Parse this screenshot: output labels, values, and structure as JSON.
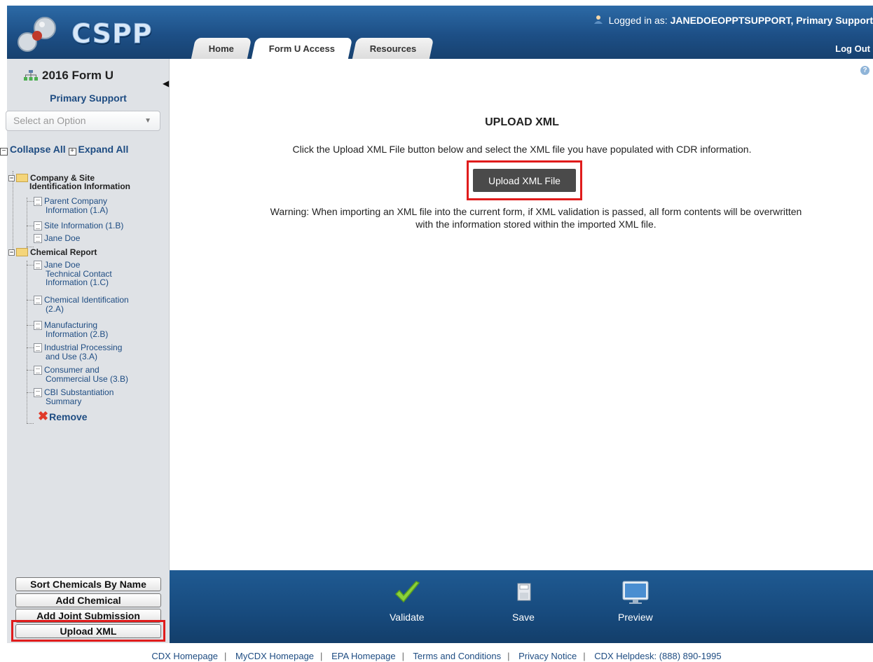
{
  "header": {
    "logo_text": "CSPP",
    "logged_in_label": "Logged in as:",
    "user_name": "JANEDOEOPPTSUPPORT, Primary Support",
    "logout_label": "Log Out",
    "tabs": [
      {
        "label": "Home",
        "active": false
      },
      {
        "label": "Form U Access",
        "active": true
      },
      {
        "label": "Resources",
        "active": false
      }
    ]
  },
  "sidebar": {
    "form_title": "2016 Form U",
    "role": "Primary Support",
    "select_placeholder": "Select an Option",
    "collapse_all": "Collapse All",
    "expand_all": "Expand All",
    "tree": {
      "group1_line1": "Company & Site",
      "group1_line2": "Identification Information",
      "g1_item1_l1": "Parent Company",
      "g1_item1_l2": "Information (1.A)",
      "g1_item2": "Site Information (1.B)",
      "g1_item3": "Jane Doe",
      "group2": "Chemical Report",
      "g2_item1_l1": "Jane Doe",
      "g2_item1_l2": "Technical Contact",
      "g2_item1_l3": "Information (1.C)",
      "g2_item2_l1": "Chemical Identification",
      "g2_item2_l2": "(2.A)",
      "g2_item3_l1": "Manufacturing",
      "g2_item3_l2": "Information (2.B)",
      "g2_item4_l1": "Industrial Processing",
      "g2_item4_l2": "and Use (3.A)",
      "g2_item5_l1": "Consumer and",
      "g2_item5_l2": "Commercial Use (3.B)",
      "g2_item6_l1": "CBI Substantiation",
      "g2_item6_l2": "Summary",
      "remove": "Remove"
    },
    "buttons": {
      "sort": "Sort Chemicals By Name",
      "add_chemical": "Add Chemical",
      "add_joint": "Add Joint Submission",
      "upload_xml": "Upload XML"
    }
  },
  "main": {
    "title": "UPLOAD XML",
    "instructions": "Click the Upload XML File button below and select the XML file you have populated with CDR information.",
    "upload_button": "Upload XML File",
    "warning_line1": "Warning: When importing an XML file into the current form, if XML validation is passed, all form contents will be overwritten",
    "warning_line2": "with the information stored within the imported XML file."
  },
  "toolbar": {
    "validate": "Validate",
    "save": "Save",
    "preview": "Preview"
  },
  "footer": {
    "links": [
      "CDX Homepage",
      "MyCDX Homepage",
      "EPA Homepage",
      "Terms and Conditions",
      "Privacy Notice",
      "CDX Helpdesk: (888) 890-1995"
    ]
  },
  "icons": {
    "help": "help-icon",
    "user": "user-icon",
    "validate": "checkmark-icon",
    "save": "floppy-disk-icon",
    "preview": "monitor-icon"
  },
  "colors": {
    "header_blue": "#1d4f86",
    "highlight_red": "#e01c1c",
    "link_blue": "#1e4c82",
    "sidebar_gray": "#dfe2e6"
  }
}
